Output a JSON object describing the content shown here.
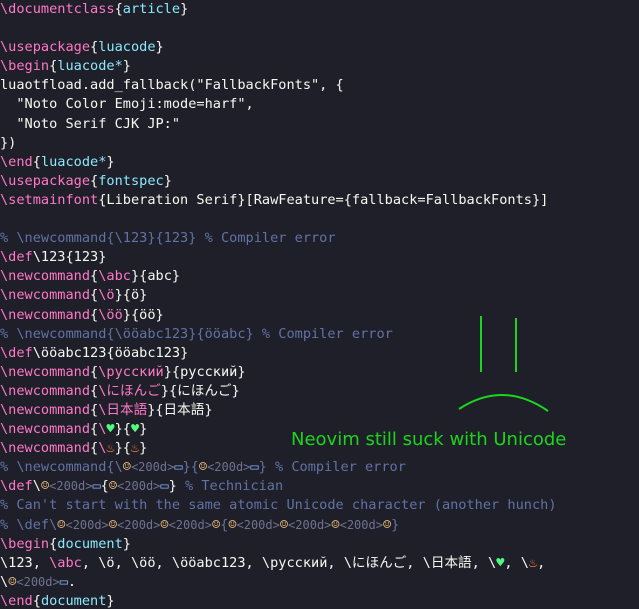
{
  "colors": {
    "background": "#1e1f29",
    "keyword": "#ff79c6",
    "argument": "#8be9fd",
    "comment": "#6272a4",
    "text": "#f8f8f2",
    "annotation": "#1cd61c"
  },
  "lines": [
    [
      {
        "c": "kw",
        "t": "\\documentclass"
      },
      {
        "t": "{"
      },
      {
        "c": "arg",
        "t": "article"
      },
      {
        "t": "}"
      }
    ],
    [],
    [
      {
        "c": "kw",
        "t": "\\usepackage"
      },
      {
        "t": "{"
      },
      {
        "c": "arg",
        "t": "luacode"
      },
      {
        "t": "}"
      }
    ],
    [
      {
        "c": "kw",
        "t": "\\begin"
      },
      {
        "t": "{"
      },
      {
        "c": "arg",
        "t": "luacode*"
      },
      {
        "t": "}"
      }
    ],
    [
      {
        "t": "luaotfload.add_fallback(\"FallbackFonts\", {"
      }
    ],
    [
      {
        "t": "  \"Noto Color Emoji:mode=harf\","
      }
    ],
    [
      {
        "t": "  \"Noto Serif CJK JP:\""
      }
    ],
    [
      {
        "t": "})"
      }
    ],
    [
      {
        "c": "kw",
        "t": "\\end"
      },
      {
        "t": "{"
      },
      {
        "c": "arg",
        "t": "luacode*"
      },
      {
        "t": "}"
      }
    ],
    [
      {
        "c": "kw",
        "t": "\\usepackage"
      },
      {
        "t": "{"
      },
      {
        "c": "arg",
        "t": "fontspec"
      },
      {
        "t": "}"
      }
    ],
    [
      {
        "c": "kw",
        "t": "\\setmainfont"
      },
      {
        "t": "{Liberation Serif}[RawFeature={fallback=FallbackFonts}]"
      }
    ],
    [],
    [
      {
        "c": "cm",
        "t": "% \\newcommand{\\123}{123} % Compiler error"
      }
    ],
    [
      {
        "c": "kw",
        "t": "\\def"
      },
      {
        "t": "\\123{123}"
      }
    ],
    [
      {
        "c": "kw",
        "t": "\\newcommand"
      },
      {
        "t": "{"
      },
      {
        "c": "kw",
        "t": "\\abc"
      },
      {
        "t": "}{abc}"
      }
    ],
    [
      {
        "c": "kw",
        "t": "\\newcommand"
      },
      {
        "t": "{"
      },
      {
        "c": "kw",
        "t": "\\ö"
      },
      {
        "t": "}{ö}"
      }
    ],
    [
      {
        "c": "kw",
        "t": "\\newcommand"
      },
      {
        "t": "{"
      },
      {
        "c": "kw",
        "t": "\\öö"
      },
      {
        "t": "}{öö}"
      }
    ],
    [
      {
        "c": "cm",
        "t": "% \\newcommand{\\ööabc123}{ööabc} % Compiler error"
      }
    ],
    [
      {
        "c": "kw",
        "t": "\\def"
      },
      {
        "t": "\\ööabc123{ööabc123}"
      }
    ],
    [
      {
        "c": "kw",
        "t": "\\newcommand"
      },
      {
        "t": "{"
      },
      {
        "c": "kw",
        "t": "\\русский"
      },
      {
        "t": "}{русский}"
      }
    ],
    [
      {
        "c": "kw",
        "t": "\\newcommand"
      },
      {
        "t": "{"
      },
      {
        "c": "kw",
        "t": "\\にほんご"
      },
      {
        "t": "}{にほんご}"
      }
    ],
    [
      {
        "c": "kw",
        "t": "\\newcommand"
      },
      {
        "t": "{"
      },
      {
        "c": "kw",
        "t": "\\日本語"
      },
      {
        "t": "}{日本語}"
      }
    ],
    [
      {
        "c": "kw",
        "t": "\\newcommand"
      },
      {
        "t": "{"
      },
      {
        "c": "kw",
        "t": "\\"
      },
      {
        "c": "heart",
        "t": "♥"
      },
      {
        "t": "}{"
      },
      {
        "c": "heart",
        "t": "♥"
      },
      {
        "t": "}"
      }
    ],
    [
      {
        "c": "kw",
        "t": "\\newcommand"
      },
      {
        "t": "{"
      },
      {
        "c": "kw",
        "t": "\\"
      },
      {
        "c": "fire",
        "t": "♨"
      },
      {
        "t": "}{"
      },
      {
        "c": "fire",
        "t": "♨"
      },
      {
        "t": "}"
      }
    ],
    [
      {
        "c": "cm",
        "t": "% \\newcommand{\\"
      },
      {
        "c": "emj",
        "t": "☺"
      },
      {
        "c": "ph",
        "t": "<200d>"
      },
      {
        "c": "lap",
        "t": "▭"
      },
      {
        "c": "cm",
        "t": "}{"
      },
      {
        "c": "emj",
        "t": "☺"
      },
      {
        "c": "ph",
        "t": "<200d>"
      },
      {
        "c": "lap",
        "t": "▭"
      },
      {
        "c": "cm",
        "t": "} % Compiler error"
      }
    ],
    [
      {
        "c": "kw",
        "t": "\\def"
      },
      {
        "t": "\\"
      },
      {
        "c": "emj",
        "t": "☺"
      },
      {
        "c": "ph",
        "t": "<200d>"
      },
      {
        "c": "lap",
        "t": "▭"
      },
      {
        "t": "{"
      },
      {
        "c": "emj",
        "t": "☺"
      },
      {
        "c": "ph",
        "t": "<200d>"
      },
      {
        "c": "lap",
        "t": "▭"
      },
      {
        "t": "} "
      },
      {
        "c": "cm",
        "t": "% Technician"
      }
    ],
    [
      {
        "c": "cm",
        "t": "% Can't start with the same atomic Unicode character (another hunch)"
      }
    ],
    [
      {
        "c": "cm",
        "t": "% \\def\\"
      },
      {
        "c": "emj",
        "t": "☺"
      },
      {
        "c": "ph",
        "t": "<200d>"
      },
      {
        "c": "emj",
        "t": "☺"
      },
      {
        "c": "ph",
        "t": "<200d>"
      },
      {
        "c": "emj",
        "t": "☺"
      },
      {
        "c": "ph",
        "t": "<200d>"
      },
      {
        "c": "emj",
        "t": "☺"
      },
      {
        "c": "cm",
        "t": "{"
      },
      {
        "c": "emj",
        "t": "☺"
      },
      {
        "c": "ph",
        "t": "<200d>"
      },
      {
        "c": "emj",
        "t": "☺"
      },
      {
        "c": "ph",
        "t": "<200d>"
      },
      {
        "c": "emj",
        "t": "☺"
      },
      {
        "c": "ph",
        "t": "<200d>"
      },
      {
        "c": "emj",
        "t": "☺"
      },
      {
        "c": "cm",
        "t": "}"
      }
    ],
    [
      {
        "c": "kw",
        "t": "\\begin"
      },
      {
        "t": "{"
      },
      {
        "c": "arg",
        "t": "document"
      },
      {
        "t": "}"
      }
    ],
    [
      {
        "t": "\\123, "
      },
      {
        "c": "kw",
        "t": "\\abc"
      },
      {
        "t": ", \\ö, \\öö, \\ööabc123, \\русский, \\にほんご, \\日本語, \\"
      },
      {
        "c": "heart",
        "t": "♥"
      },
      {
        "t": ", \\"
      },
      {
        "c": "fire",
        "t": "♨"
      },
      {
        "t": ", "
      }
    ],
    [
      {
        "t": "\\"
      },
      {
        "c": "emj",
        "t": "☺"
      },
      {
        "c": "ph",
        "t": "<200d>"
      },
      {
        "c": "lap",
        "t": "▭"
      },
      {
        "t": "."
      }
    ],
    [
      {
        "c": "kw",
        "t": "\\end"
      },
      {
        "t": "{"
      },
      {
        "c": "arg",
        "t": "document"
      },
      {
        "t": "}"
      }
    ]
  ],
  "annotation": {
    "caption": "Neovim still suck with Unicode",
    "drawing": "sad-face"
  }
}
